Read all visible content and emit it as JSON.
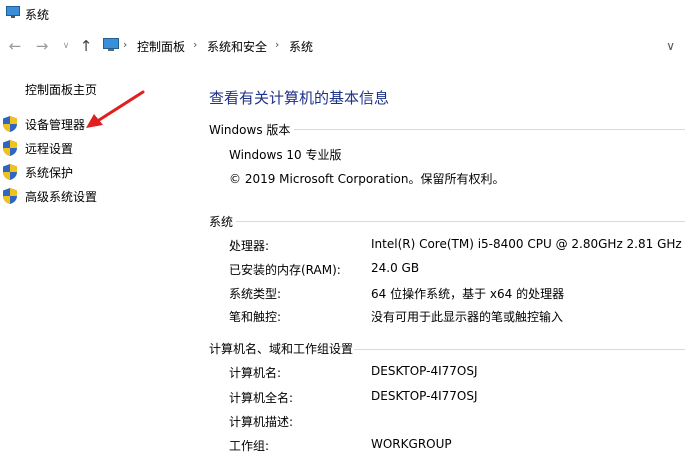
{
  "window": {
    "title": "系统"
  },
  "breadcrumb": [
    "控制面板",
    "系统和安全",
    "系统"
  ],
  "left_pane": {
    "home_link": "控制面板主页",
    "items": [
      "设备管理器",
      "远程设置",
      "系统保护",
      "高级系统设置"
    ]
  },
  "main": {
    "title": "查看有关计算机的基本信息",
    "edition": {
      "header": "Windows 版本",
      "name": "Windows 10 专业版",
      "copyright": "© 2019 Microsoft Corporation。保留所有权利。"
    },
    "system": {
      "header": "系统",
      "rows": [
        {
          "label": "处理器:",
          "value": "Intel(R) Core(TM) i5-8400 CPU @ 2.80GHz   2.81 GHz"
        },
        {
          "label": "已安装的内存(RAM):",
          "value": "24.0 GB"
        },
        {
          "label": "系统类型:",
          "value": "64 位操作系统，基于 x64 的处理器"
        },
        {
          "label": "笔和触控:",
          "value": "没有可用于此显示器的笔或触控输入"
        }
      ]
    },
    "computer": {
      "header": "计算机名、域和工作组设置",
      "rows": [
        {
          "label": "计算机名:",
          "value": "DESKTOP-4I77OSJ"
        },
        {
          "label": "计算机全名:",
          "value": "DESKTOP-4I77OSJ"
        },
        {
          "label": "计算机描述:",
          "value": ""
        },
        {
          "label": "工作组:",
          "value": "WORKGROUP"
        }
      ]
    }
  },
  "colors": {
    "title_blue": "#1e3287",
    "annotation_red": "#e02020"
  }
}
